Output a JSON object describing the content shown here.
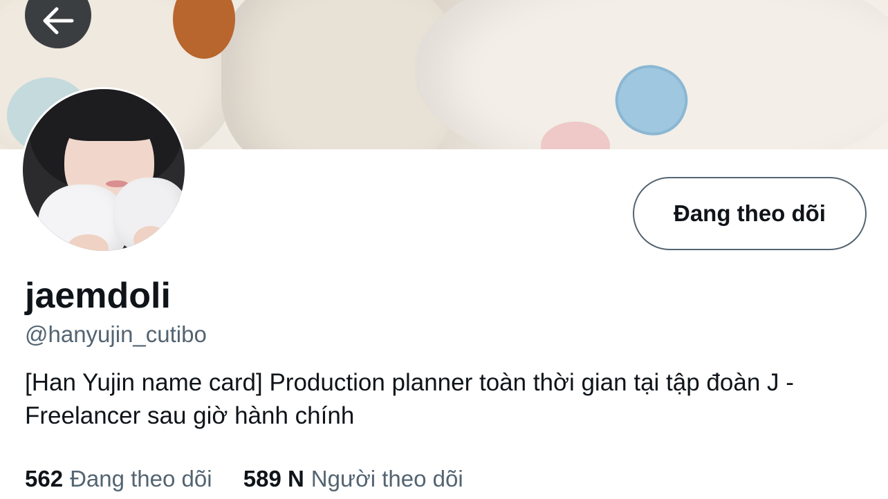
{
  "profile": {
    "display_name": "jaemdoli",
    "handle": "@hanyujin_cutibo",
    "bio": "[Han Yujin name card] Production planner toàn thời gian tại tập đoàn J - Freelancer sau giờ hành chính",
    "follow_button_label": "Đang theo dõi"
  },
  "stats": {
    "following_count": "562",
    "following_label": "Đang theo dõi",
    "followers_count": "589 N",
    "followers_label": "Người theo dõi"
  },
  "icons": {
    "back": "arrow-left-icon"
  },
  "colors": {
    "text_primary": "#0f1419",
    "text_secondary": "#536471",
    "back_button_bg": "#3b3e41"
  }
}
